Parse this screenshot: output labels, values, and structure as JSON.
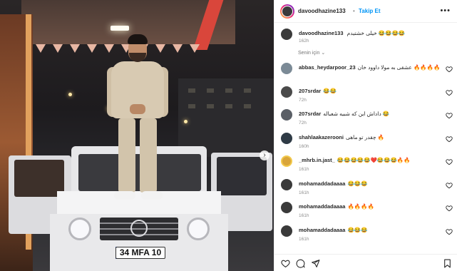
{
  "post_author": {
    "username": "davoodhazine133",
    "follow_label": "Takip Et",
    "more_label": "•••"
  },
  "caption": {
    "username": "davoodhazine133",
    "text": "خیلی خشتیدم 😂😂😂😂",
    "time": "162h"
  },
  "sort": {
    "label": "Senin için",
    "chevron": "⌄"
  },
  "photo": {
    "plate_text": "34 MFA 10",
    "next_arrow": "›"
  },
  "comments": [
    {
      "username": "abbas_heydarpoor_23",
      "text": "عشقی به مولا داوود خان 🔥🔥🔥🔥",
      "time": ""
    },
    {
      "username": "207srdar",
      "text": "😂😂",
      "time": "72h"
    },
    {
      "username": "207srdar",
      "text": "داداش این که شبیه شعباله 😂",
      "time": "72h"
    },
    {
      "username": "shahlaakazerooni",
      "text": "چقدر تو ماهی 🔥",
      "time": "160h"
    },
    {
      "username": "_mhrb.in.jast_",
      "text": "😂😂😂😂😂❤️😂😂😂🔥🔥",
      "time": "161h"
    },
    {
      "username": "mohamaddadaaaa",
      "text": "😂😂😂",
      "time": "161h"
    },
    {
      "username": "mohamaddadaaaa",
      "text": "🔥🔥🔥🔥",
      "time": "161h"
    },
    {
      "username": "mohamaddadaaaa",
      "text": "😂😂😂",
      "time": "161h"
    }
  ],
  "actions": {
    "like_icon": "heart-icon",
    "comment_icon": "comment-icon",
    "share_icon": "share-icon",
    "save_icon": "bookmark-icon"
  },
  "colors": {
    "link_blue": "#0095f6",
    "text": "#262626",
    "meta_gray": "#8e8e8e"
  }
}
